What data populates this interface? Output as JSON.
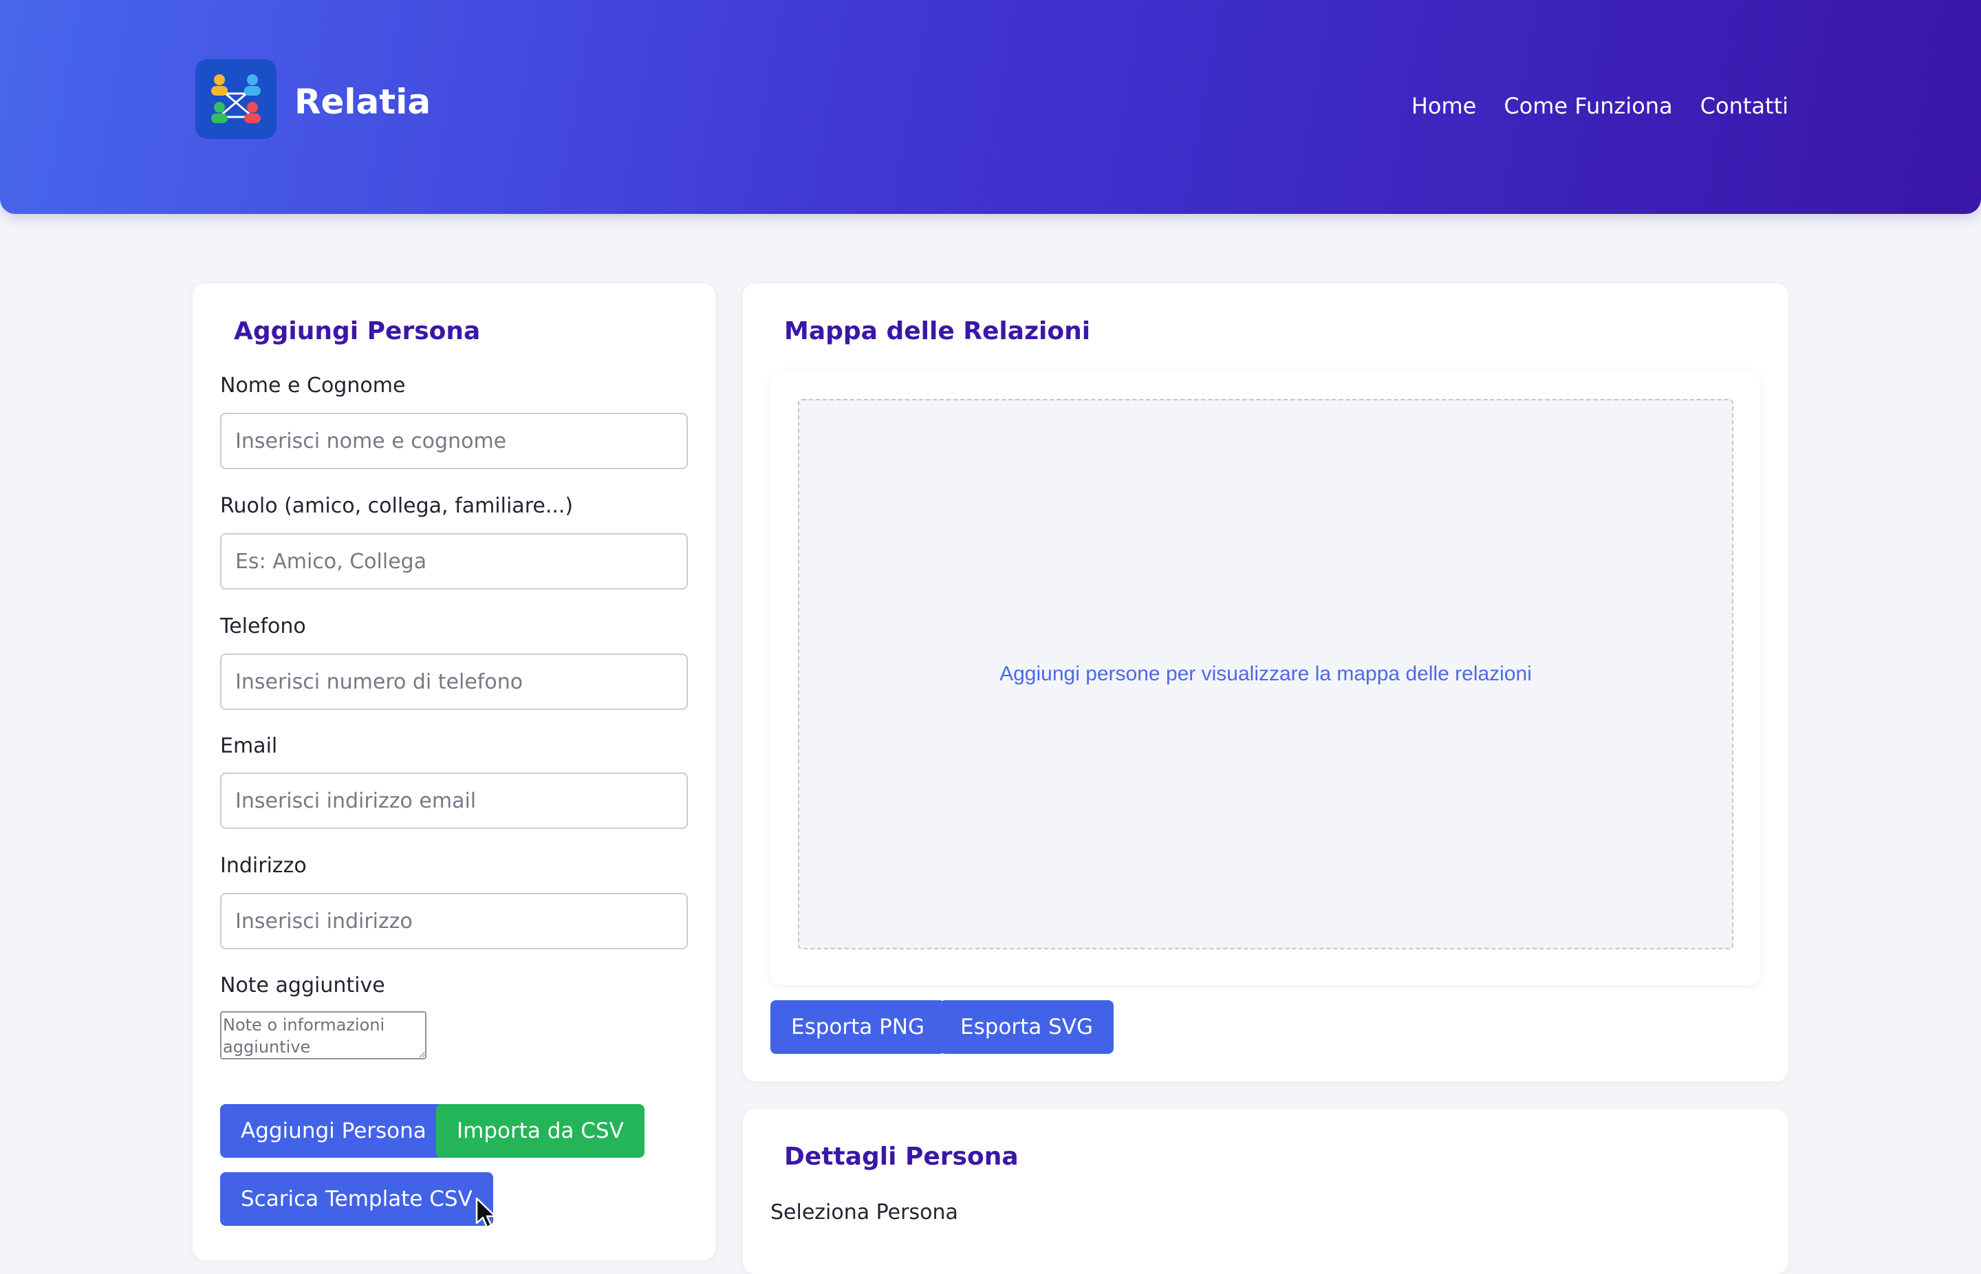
{
  "header": {
    "brand": "Relatia",
    "logo_icon": "people-network-icon",
    "nav": [
      "Home",
      "Come Funziona",
      "Contatti"
    ]
  },
  "form": {
    "title": "Aggiungi Persona",
    "fields": {
      "name": {
        "label": "Nome e Cognome",
        "placeholder": "Inserisci nome e cognome",
        "value": ""
      },
      "role": {
        "label": "Ruolo (amico, collega, familiare...)",
        "placeholder": "Es: Amico, Collega",
        "value": ""
      },
      "phone": {
        "label": "Telefono",
        "placeholder": "Inserisci numero di telefono",
        "value": ""
      },
      "email": {
        "label": "Email",
        "placeholder": "Inserisci indirizzo email",
        "value": ""
      },
      "address": {
        "label": "Indirizzo",
        "placeholder": "Inserisci indirizzo",
        "value": ""
      },
      "notes": {
        "label": "Note aggiuntive",
        "placeholder": "Note o informazioni aggiuntive",
        "value": ""
      }
    },
    "buttons": {
      "add": "Aggiungi Persona",
      "import_csv": "Importa da CSV",
      "download_template": "Scarica Template CSV"
    }
  },
  "map": {
    "title": "Mappa delle Relazioni",
    "empty_message": "Aggiungi persone per visualizzare la mappa delle relazioni",
    "buttons": {
      "export_png": "Esporta PNG",
      "export_svg": "Esporta SVG"
    }
  },
  "details": {
    "title": "Dettagli Persona",
    "select_label": "Seleziona Persona"
  },
  "colors": {
    "header_gradient_start": "#4866ec",
    "header_gradient_end": "#3a15a8",
    "title_purple": "#3a17a8",
    "button_blue": "#4262e8",
    "button_green": "#24b559",
    "map_message_blue": "#4a6ae8",
    "page_background": "#f4f5f9"
  }
}
